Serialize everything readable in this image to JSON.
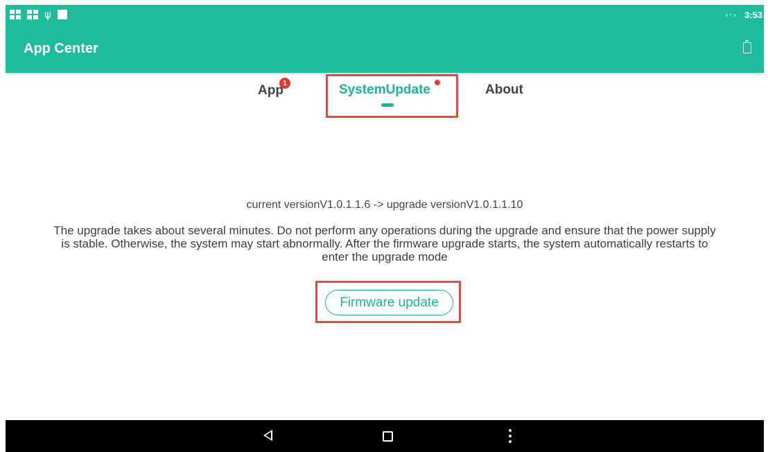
{
  "status_bar": {
    "icons_left": [
      "notification-grid-icon",
      "notification-grid-icon",
      "usb-icon",
      "square-icon"
    ],
    "network_glyph": "‹·›",
    "time": "3:53"
  },
  "app_bar": {
    "title": "App Center",
    "action_icon": "clear-icon"
  },
  "tabs": [
    {
      "label": "App",
      "badge": "1"
    },
    {
      "label": "SystemUpdate",
      "selected": true,
      "dot": true
    },
    {
      "label": "About"
    }
  ],
  "content": {
    "version_line": "current versionV1.0.1.1.6 -> upgrade versionV1.0.1.1.10",
    "warning_lines": [
      "The upgrade takes about several minutes. Do not perform any operations during the upgrade and ensure that the power supply",
      "is stable. Otherwise, the system may start abnormally. After the firmware upgrade starts, the system automatically restarts to",
      "enter the upgrade mode"
    ],
    "button_label": "Firmware update"
  },
  "nav_bar": {
    "icons": [
      "back-icon",
      "home-icon",
      "menu-icon"
    ]
  },
  "colors": {
    "accent": "#1dbd9b",
    "accent_text": "#1db395",
    "highlight": "#e64747",
    "badge": "#e53935",
    "nav_bar": "#000000"
  }
}
